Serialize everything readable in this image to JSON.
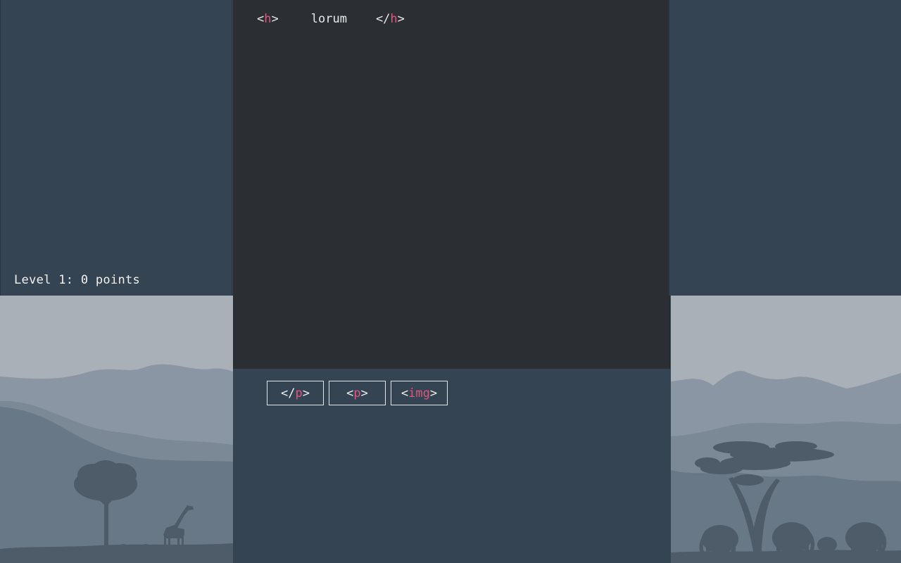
{
  "status": {
    "text": "Level 1: 0 points"
  },
  "editor": {
    "line": {
      "open_tag": "h",
      "content": "lorum",
      "close_tag": "h"
    }
  },
  "palette": {
    "tokens": [
      {
        "prefix": "</",
        "name": "p",
        "suffix": ">"
      },
      {
        "prefix": "<",
        "name": "p",
        "suffix": ">"
      },
      {
        "prefix": "<",
        "name": "img",
        "suffix": ">"
      }
    ]
  },
  "colors": {
    "background": "#344453",
    "editor_bg": "#2b2f34",
    "tag_accent": "#e0567d",
    "text": "#e9e9e9"
  }
}
